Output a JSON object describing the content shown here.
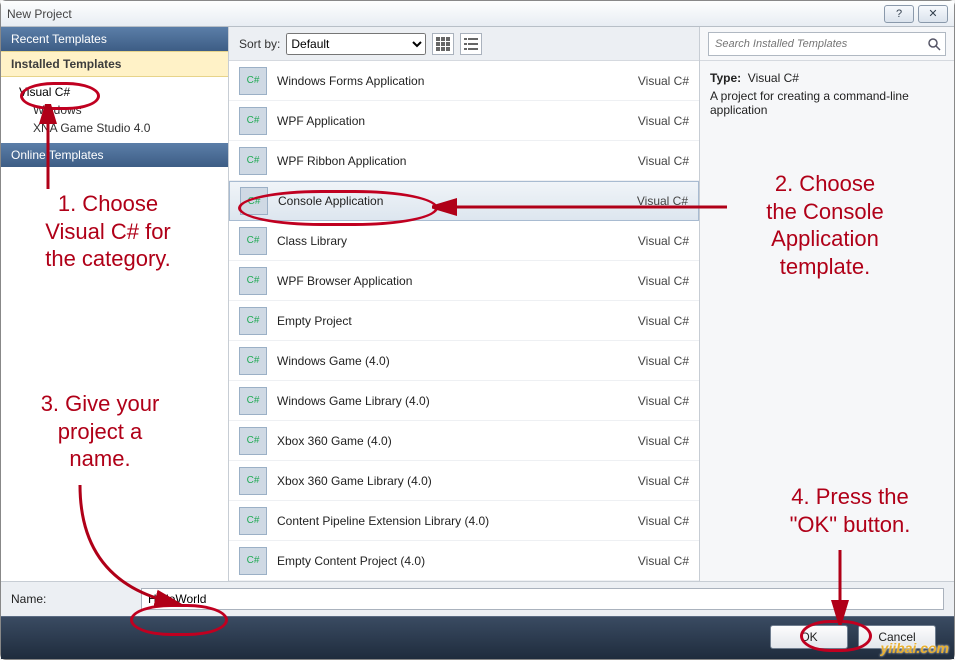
{
  "window": {
    "title": "New Project"
  },
  "sidebar": {
    "recent": "Recent Templates",
    "installed": "Installed Templates",
    "online": "Online Templates",
    "tree": {
      "item0": "Visual C#",
      "item1": "Windows",
      "item2": "XNA Game Studio 4.0"
    }
  },
  "sort": {
    "label": "Sort by:",
    "value": "Default"
  },
  "templates": [
    {
      "name": "Windows Forms Application",
      "lang": "Visual C#"
    },
    {
      "name": "WPF Application",
      "lang": "Visual C#"
    },
    {
      "name": "WPF Ribbon Application",
      "lang": "Visual C#"
    },
    {
      "name": "Console Application",
      "lang": "Visual C#",
      "selected": true
    },
    {
      "name": "Class Library",
      "lang": "Visual C#"
    },
    {
      "name": "WPF Browser Application",
      "lang": "Visual C#"
    },
    {
      "name": "Empty Project",
      "lang": "Visual C#"
    },
    {
      "name": "Windows Game (4.0)",
      "lang": "Visual C#"
    },
    {
      "name": "Windows Game Library (4.0)",
      "lang": "Visual C#"
    },
    {
      "name": "Xbox 360 Game (4.0)",
      "lang": "Visual C#"
    },
    {
      "name": "Xbox 360 Game Library (4.0)",
      "lang": "Visual C#"
    },
    {
      "name": "Content Pipeline Extension Library (4.0)",
      "lang": "Visual C#"
    },
    {
      "name": "Empty Content Project (4.0)",
      "lang": "Visual C#"
    }
  ],
  "search": {
    "placeholder": "Search Installed Templates"
  },
  "detail": {
    "type_label": "Type:",
    "type_value": "Visual C#",
    "desc": "A project for creating a command-line application"
  },
  "name_field": {
    "label": "Name:",
    "value": "HelloWorld"
  },
  "buttons": {
    "ok": "OK",
    "cancel": "Cancel"
  },
  "annotations": {
    "a1": "1. Choose\nVisual C# for\nthe category.",
    "a2": "2. Choose\nthe Console\nApplication\ntemplate.",
    "a3": "3. Give your\nproject a\nname.",
    "a4": "4. Press the\n\"OK\" button."
  },
  "watermark": "yiibai.com"
}
